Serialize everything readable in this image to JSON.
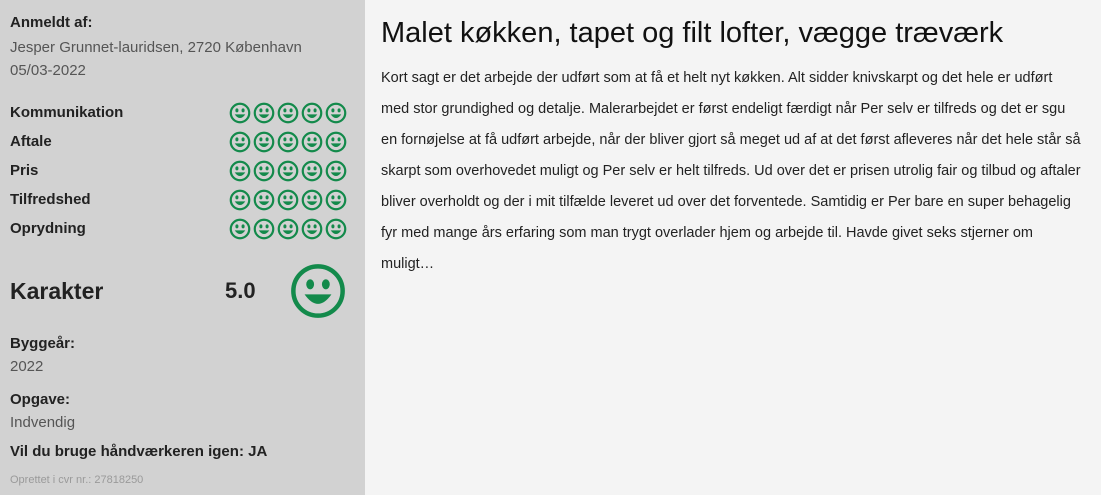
{
  "reviewer": {
    "label": "Anmeldt af:",
    "name_location": "Jesper Grunnet-lauridsen, 2720 København",
    "date": "05/03-2022"
  },
  "ratings": [
    {
      "label": "Kommunikation",
      "score": 5,
      "max": 5
    },
    {
      "label": "Aftale",
      "score": 5,
      "max": 5
    },
    {
      "label": "Pris",
      "score": 5,
      "max": 5
    },
    {
      "label": "Tilfredshed",
      "score": 5,
      "max": 5
    },
    {
      "label": "Oprydning",
      "score": 5,
      "max": 5
    }
  ],
  "karakter": {
    "label": "Karakter",
    "score": "5.0"
  },
  "build_year": {
    "label": "Byggeår:",
    "value": "2022"
  },
  "task": {
    "label": "Opgave:",
    "value": "Indvendig"
  },
  "use_again": "Vil du bruge håndværkeren igen: JA",
  "cvr": "Oprettet i cvr nr.: 27818250",
  "review": {
    "title": "Malet køkken, tapet og filt lofter, vægge træværk",
    "body": "Kort sagt er det arbejde der udført som at få et helt nyt køkken. Alt sidder knivskarpt og det hele er udført med stor grundighed og detalje. Malerarbejdet er først endeligt færdigt når Per selv er tilfreds og det er sgu en fornøjelse at få udført arbejde, når der bliver gjort så meget ud af at det først afleveres når det hele står så skarpt som overhovedet muligt og Per selv er helt tilfreds. Ud over det er prisen utrolig fair og tilbud og aftaler bliver overholdt og der i mit tilfælde leveret ud over det forventede. Samtidig er Per bare en super behagelig fyr med mange års erfaring som man trygt overlader hjem og arbejde til. Havde givet seks stjerner om muligt…"
  },
  "colors": {
    "smiley_green": "#138a4b",
    "sidebar_bg": "#d2d2d2",
    "main_bg": "#f4f4f4"
  },
  "icons": {
    "rating": "smiley-face-icon"
  }
}
